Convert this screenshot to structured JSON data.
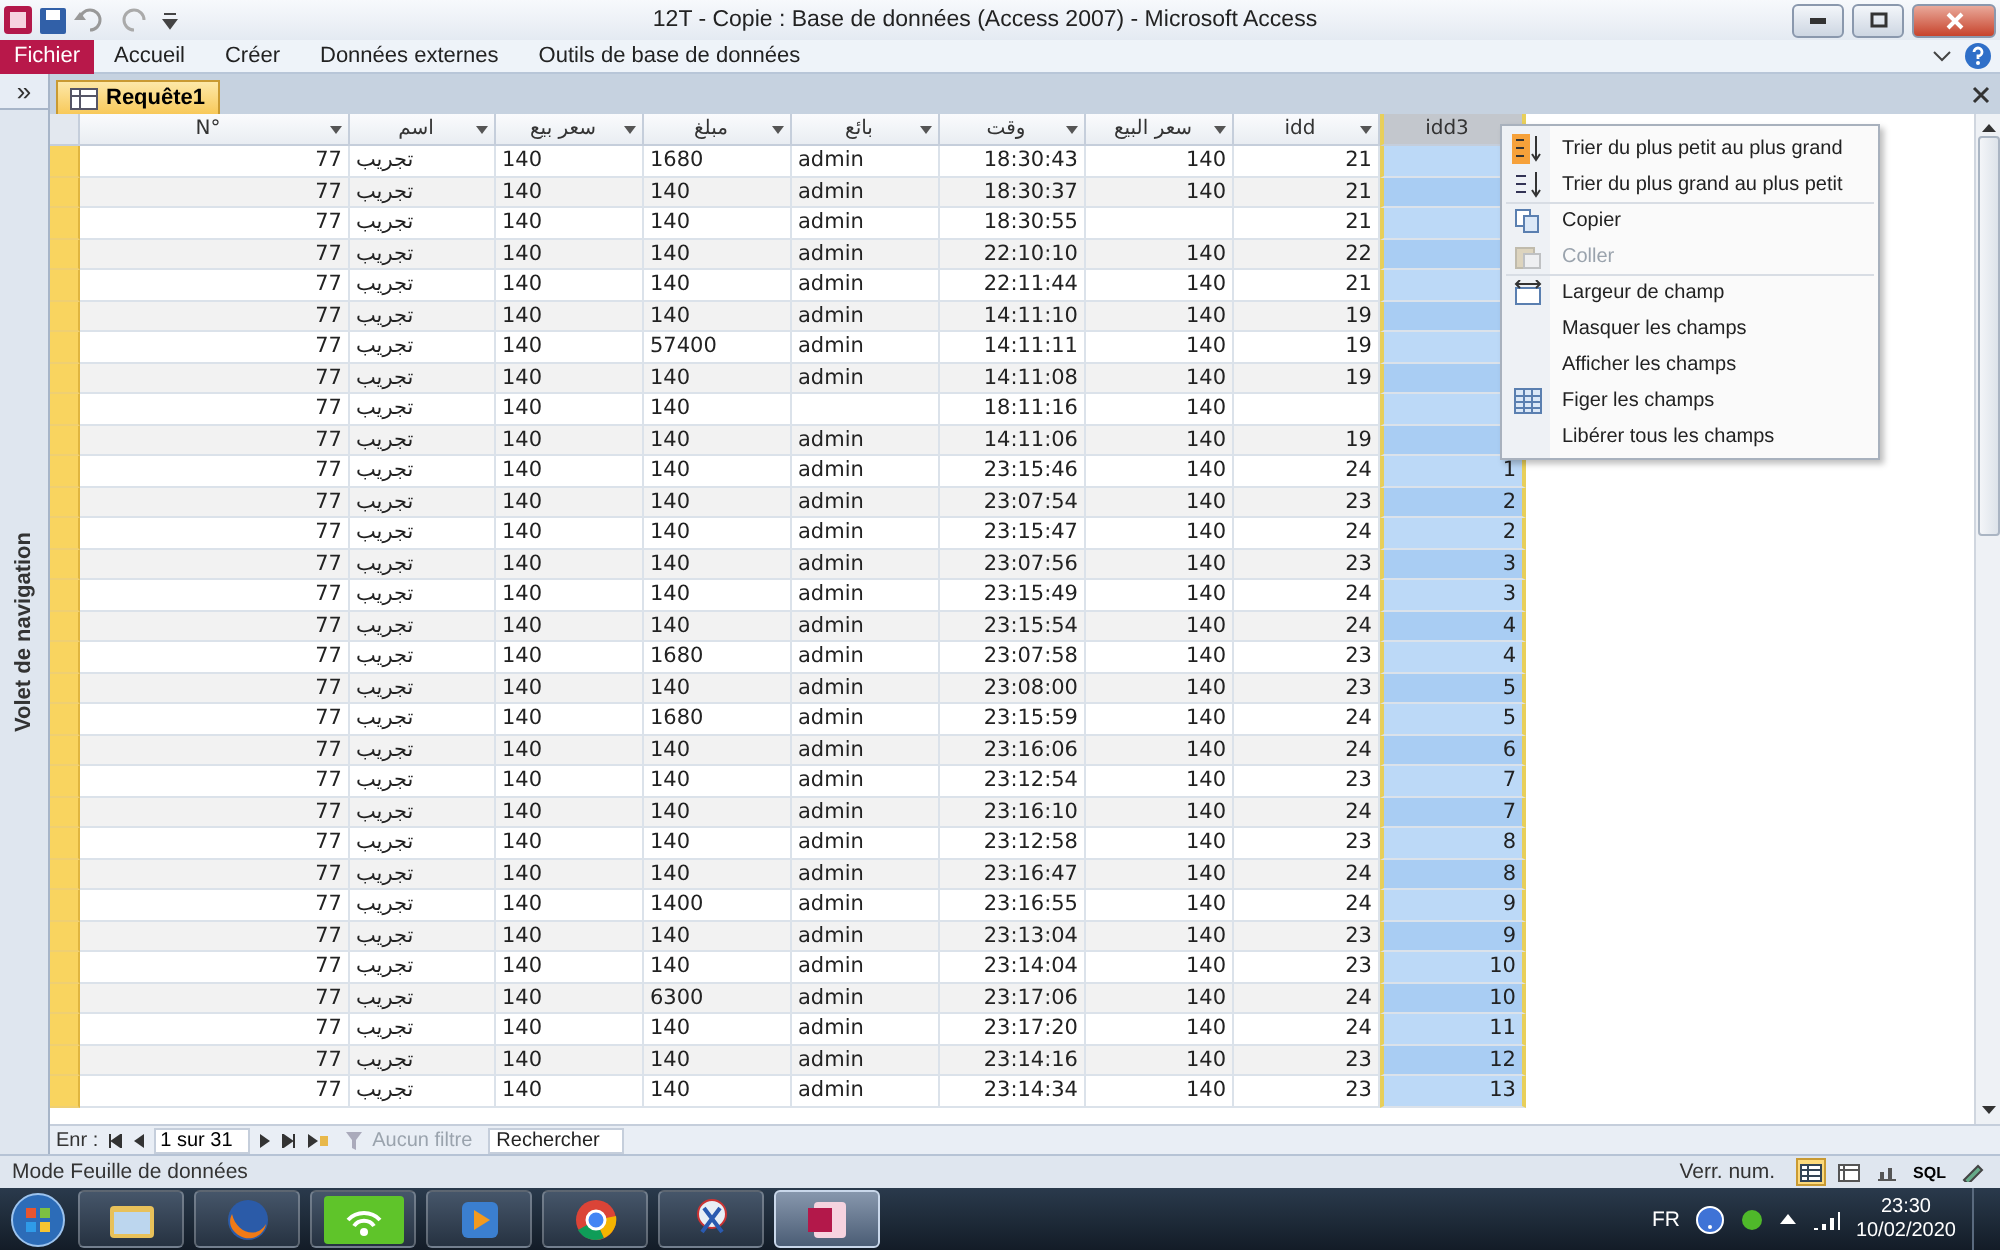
{
  "window": {
    "title": "12T - Copie : Base de données (Access 2007)  -  Microsoft Access"
  },
  "ribbon": {
    "file_tab": "Fichier",
    "tabs": [
      {
        "label": "Accueil",
        "selected": false
      },
      {
        "label": "Créer",
        "selected": false
      },
      {
        "label": "Données externes",
        "selected": false
      },
      {
        "label": "Outils de base de données",
        "selected": false
      }
    ]
  },
  "navigation_pane": {
    "toggle": "»",
    "label": "Volet de navigation"
  },
  "document_tab": {
    "label": "Requête1"
  },
  "table": {
    "columns": [
      {
        "label": "N°",
        "selected": false
      },
      {
        "label": "اسم",
        "selected": false
      },
      {
        "label": "سعر بيع",
        "selected": false
      },
      {
        "label": "مبلغ",
        "selected": false
      },
      {
        "label": "بائع",
        "selected": false
      },
      {
        "label": "وقت",
        "selected": false
      },
      {
        "label": "سعر البيع",
        "selected": false
      },
      {
        "label": "idd",
        "selected": false
      },
      {
        "label": "idd3",
        "selected": true
      }
    ],
    "rows": [
      {
        "cells": [
          "77",
          "تجريب",
          "140",
          "1680",
          "admin",
          "18:30:43",
          "140",
          "21",
          null
        ]
      },
      {
        "cells": [
          "77",
          "تجريب",
          "140",
          "140",
          "admin",
          "18:30:37",
          "140",
          "21",
          null
        ]
      },
      {
        "cells": [
          "77",
          "تجريب",
          "140",
          "140",
          "admin",
          "18:30:55",
          null,
          "21",
          null
        ]
      },
      {
        "cells": [
          "77",
          "تجريب",
          "140",
          "140",
          "admin",
          "22:10:10",
          "140",
          "22",
          null
        ]
      },
      {
        "cells": [
          "77",
          "تجريب",
          "140",
          "140",
          "admin",
          "22:11:44",
          "140",
          "21",
          null
        ]
      },
      {
        "cells": [
          "77",
          "تجريب",
          "140",
          "140",
          "admin",
          "14:11:10",
          "140",
          "19",
          null
        ]
      },
      {
        "cells": [
          "77",
          "تجريب",
          "140",
          "57400",
          "admin",
          "14:11:11",
          "140",
          "19",
          null
        ]
      },
      {
        "cells": [
          "77",
          "تجريب",
          "140",
          "140",
          "admin",
          "14:11:08",
          "140",
          "19",
          null
        ]
      },
      {
        "cells": [
          "77",
          "تجريب",
          "140",
          "140",
          null,
          "18:11:16",
          "140",
          null,
          null
        ]
      },
      {
        "cells": [
          "77",
          "تجريب",
          "140",
          "140",
          "admin",
          "14:11:06",
          "140",
          "19",
          null
        ]
      },
      {
        "cells": [
          "77",
          "تجريب",
          "140",
          "140",
          "admin",
          "23:15:46",
          "140",
          "24",
          "1"
        ]
      },
      {
        "cells": [
          "77",
          "تجريب",
          "140",
          "140",
          "admin",
          "23:07:54",
          "140",
          "23",
          "2"
        ]
      },
      {
        "cells": [
          "77",
          "تجريب",
          "140",
          "140",
          "admin",
          "23:15:47",
          "140",
          "24",
          "2"
        ]
      },
      {
        "cells": [
          "77",
          "تجريب",
          "140",
          "140",
          "admin",
          "23:07:56",
          "140",
          "23",
          "3"
        ]
      },
      {
        "cells": [
          "77",
          "تجريب",
          "140",
          "140",
          "admin",
          "23:15:49",
          "140",
          "24",
          "3"
        ]
      },
      {
        "cells": [
          "77",
          "تجريب",
          "140",
          "140",
          "admin",
          "23:15:54",
          "140",
          "24",
          "4"
        ]
      },
      {
        "cells": [
          "77",
          "تجريب",
          "140",
          "1680",
          "admin",
          "23:07:58",
          "140",
          "23",
          "4"
        ]
      },
      {
        "cells": [
          "77",
          "تجريب",
          "140",
          "140",
          "admin",
          "23:08:00",
          "140",
          "23",
          "5"
        ]
      },
      {
        "cells": [
          "77",
          "تجريب",
          "140",
          "1680",
          "admin",
          "23:15:59",
          "140",
          "24",
          "5"
        ]
      },
      {
        "cells": [
          "77",
          "تجريب",
          "140",
          "140",
          "admin",
          "23:16:06",
          "140",
          "24",
          "6"
        ]
      },
      {
        "cells": [
          "77",
          "تجريب",
          "140",
          "140",
          "admin",
          "23:12:54",
          "140",
          "23",
          "7"
        ]
      },
      {
        "cells": [
          "77",
          "تجريب",
          "140",
          "140",
          "admin",
          "23:16:10",
          "140",
          "24",
          "7"
        ]
      },
      {
        "cells": [
          "77",
          "تجريب",
          "140",
          "140",
          "admin",
          "23:12:58",
          "140",
          "23",
          "8"
        ]
      },
      {
        "cells": [
          "77",
          "تجريب",
          "140",
          "140",
          "admin",
          "23:16:47",
          "140",
          "24",
          "8"
        ]
      },
      {
        "cells": [
          "77",
          "تجريب",
          "140",
          "1400",
          "admin",
          "23:16:55",
          "140",
          "24",
          "9"
        ]
      },
      {
        "cells": [
          "77",
          "تجريب",
          "140",
          "140",
          "admin",
          "23:13:04",
          "140",
          "23",
          "9"
        ]
      },
      {
        "cells": [
          "77",
          "تجريب",
          "140",
          "140",
          "admin",
          "23:14:04",
          "140",
          "23",
          "10"
        ]
      },
      {
        "cells": [
          "77",
          "تجريب",
          "140",
          "6300",
          "admin",
          "23:17:06",
          "140",
          "24",
          "10"
        ]
      },
      {
        "cells": [
          "77",
          "تجريب",
          "140",
          "140",
          "admin",
          "23:17:20",
          "140",
          "24",
          "11"
        ]
      },
      {
        "cells": [
          "77",
          "تجريب",
          "140",
          "140",
          "admin",
          "23:14:16",
          "140",
          "23",
          "12"
        ]
      },
      {
        "cells": [
          "77",
          "تجريب",
          "140",
          "140",
          "admin",
          "23:14:34",
          "140",
          "23",
          "13"
        ]
      }
    ]
  },
  "context_menu": {
    "items": [
      {
        "kind": "sort-asc",
        "label": "Trier du plus petit au plus grand",
        "disabled": false,
        "separator": false
      },
      {
        "kind": "sort-desc",
        "label": "Trier du plus grand au plus petit",
        "disabled": false,
        "separator": false
      },
      {
        "kind": "copy",
        "label": "Copier",
        "disabled": false,
        "separator": true
      },
      {
        "kind": "paste",
        "label": "Coller",
        "disabled": true,
        "separator": false
      },
      {
        "kind": "width",
        "label": "Largeur de champ",
        "disabled": false,
        "separator": true
      },
      {
        "kind": "plain",
        "label": "Masquer les champs",
        "disabled": false,
        "separator": false
      },
      {
        "kind": "plain",
        "label": "Afficher les champs",
        "disabled": false,
        "separator": false
      },
      {
        "kind": "freeze",
        "label": "Figer les champs",
        "disabled": false,
        "separator": false
      },
      {
        "kind": "plain",
        "label": "Libérer tous les champs",
        "disabled": false,
        "separator": false
      }
    ]
  },
  "record_nav": {
    "label": "Enr :",
    "position": "1 sur 31",
    "filter": "Aucun filtre",
    "filter_disabled": true,
    "search_placeholder": "Rechercher"
  },
  "status_bar": {
    "mode": "Mode Feuille de données",
    "num_lock": "Verr. num.",
    "views": [
      {
        "kind": "datasheet",
        "selected": true
      },
      {
        "kind": "pivot-table",
        "selected": false
      },
      {
        "kind": "pivot-chart",
        "selected": false
      },
      {
        "kind": "sql",
        "label": "SQL",
        "selected": false
      },
      {
        "kind": "design",
        "selected": false
      }
    ]
  },
  "taskbar": {
    "apps": [
      {
        "kind": "folder",
        "selected": false
      },
      {
        "kind": "firefox",
        "selected": false
      },
      {
        "kind": "wifi",
        "selected": false
      },
      {
        "kind": "media",
        "selected": false
      },
      {
        "kind": "chrome",
        "selected": false
      },
      {
        "kind": "scissors",
        "selected": false
      },
      {
        "kind": "access",
        "selected": true
      }
    ],
    "language": "FR",
    "time": "23:30",
    "date": "10/02/2020"
  }
}
